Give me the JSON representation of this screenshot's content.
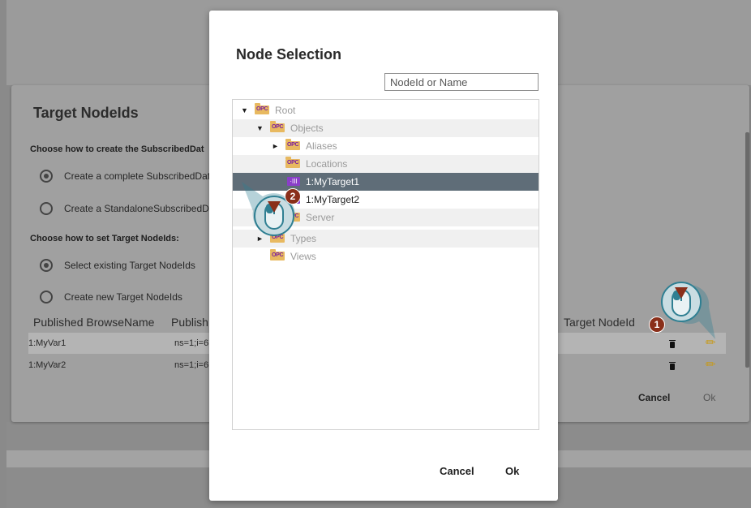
{
  "background_dialog": {
    "title": "Target NodeIds",
    "section1_label": "Choose how to create the SubscribedDat",
    "option_complete": "Create a complete SubscribedDat",
    "option_standalone": "Create a StandaloneSubscribedD",
    "section2_label": "Choose how to set Target NodeIds:",
    "option_select_existing": "Select existing Target NodeIds",
    "option_create_new": "Create new Target NodeIds",
    "table": {
      "headers": [
        "Published BrowseName",
        "Publish",
        "Target NodeId"
      ],
      "rows": [
        {
          "browse_name": "1:MyVar1",
          "published": "ns=1;i=6"
        },
        {
          "browse_name": "1:MyVar2",
          "published": "ns=1;i=6"
        }
      ]
    },
    "cancel_label": "Cancel",
    "ok_label": "Ok"
  },
  "modal": {
    "title": "Node Selection",
    "search_placeholder": "NodeId or Name",
    "folder_badge": "OPC",
    "var_badge": "·III",
    "tree": {
      "root": "Root",
      "objects": "Objects",
      "aliases": "Aliases",
      "locations": "Locations",
      "target1": "1:MyTarget1",
      "target2": "1:MyTarget2",
      "server": "Server",
      "types": "Types",
      "views": "Views"
    },
    "cancel_label": "Cancel",
    "ok_label": "Ok"
  },
  "callouts": {
    "step1": "1",
    "step2": "2"
  },
  "colors": {
    "selected_row": "#5f6d78",
    "folder": "#e8b960",
    "callout": "#2f7f92",
    "badge": "#8a2f1a"
  }
}
